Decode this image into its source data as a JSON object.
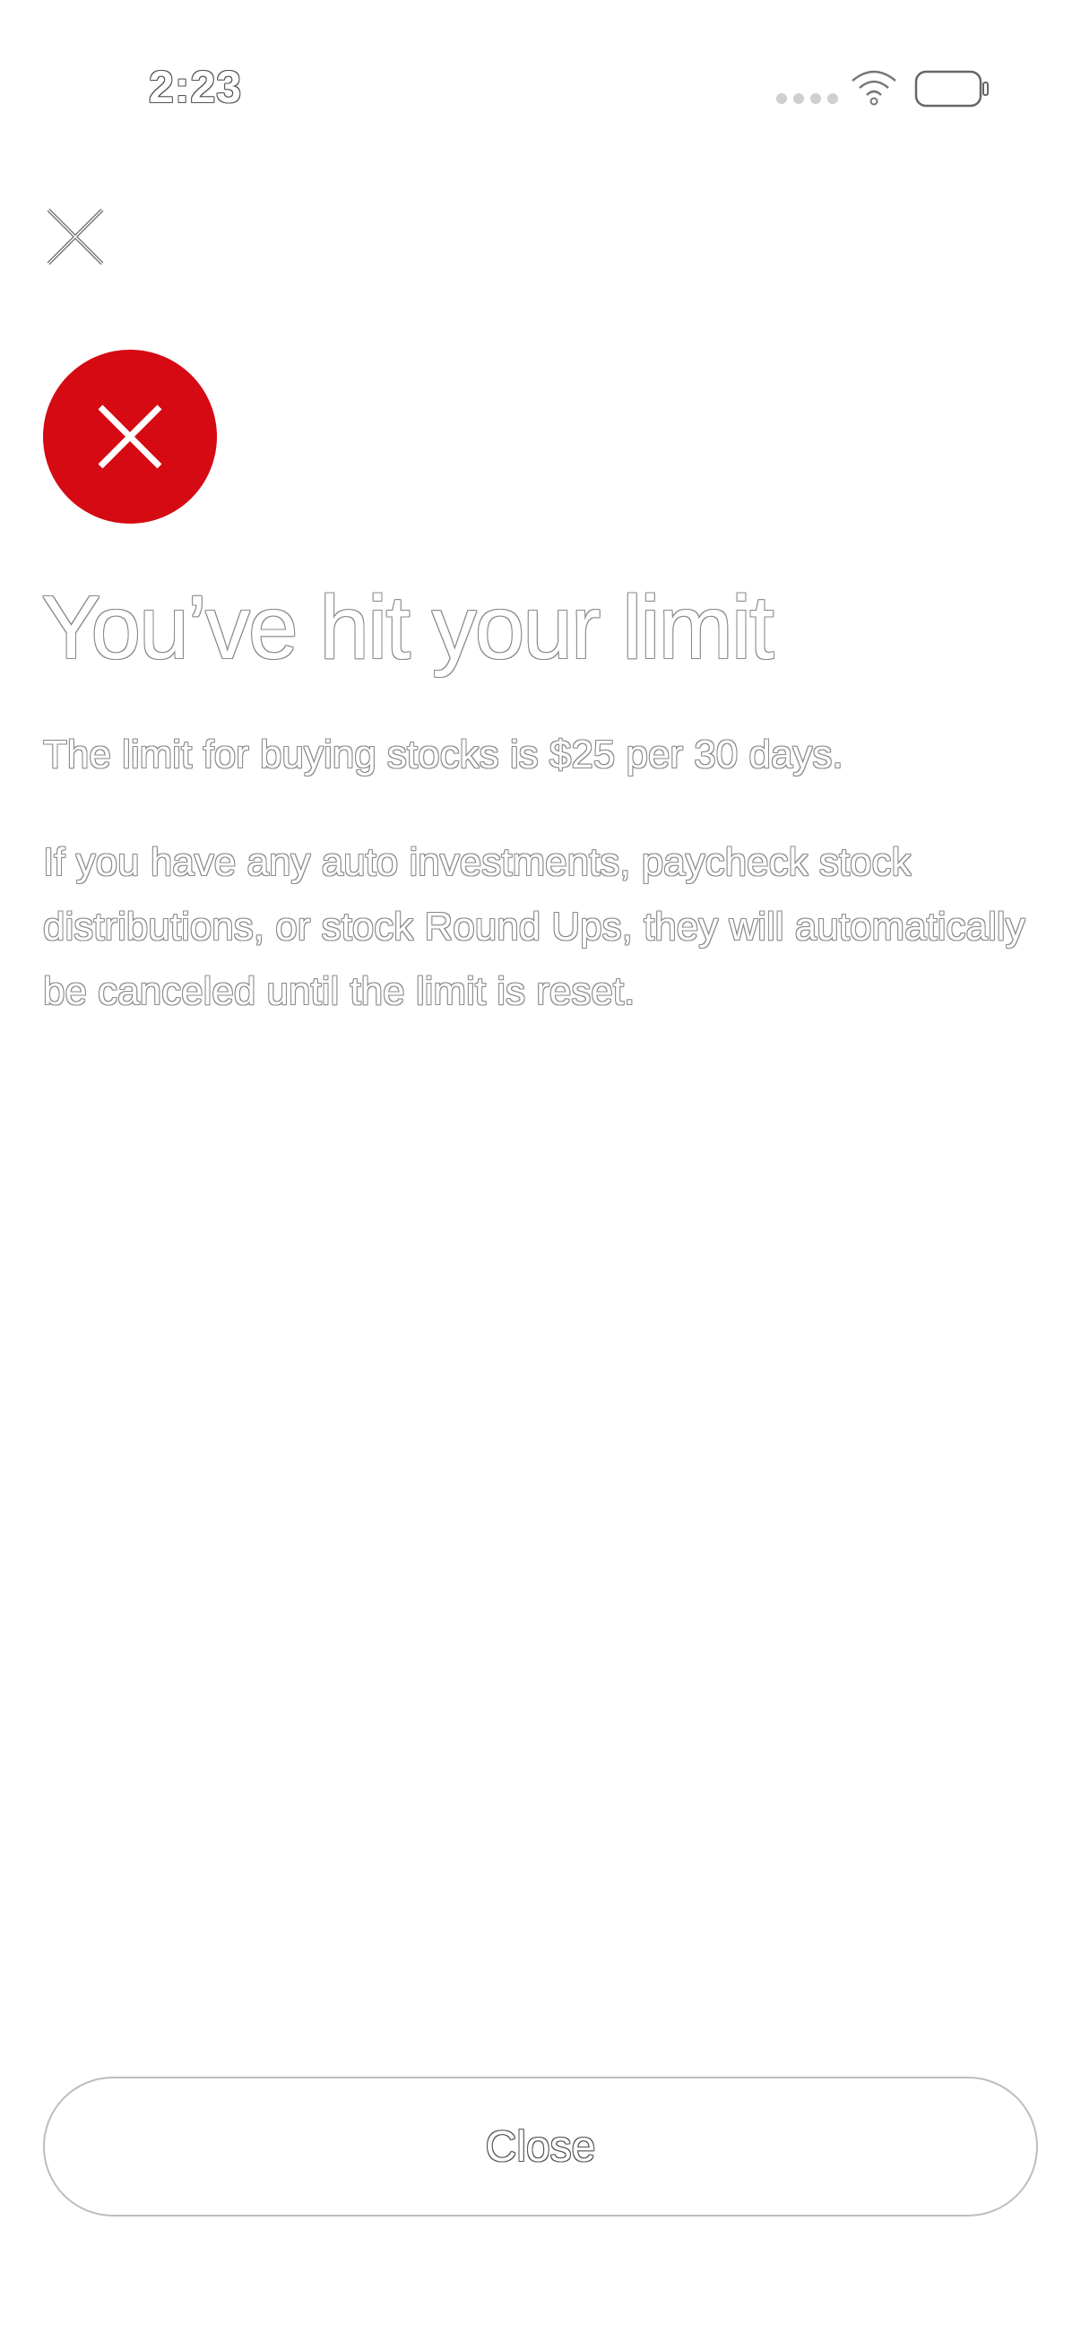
{
  "status_bar": {
    "time": "2:23",
    "signal_icon": "cellular-dots-icon",
    "wifi_icon": "wifi-icon",
    "battery_icon": "battery-icon"
  },
  "top_close": {
    "icon": "close-icon"
  },
  "error_icon": {
    "icon": "x-mark-icon",
    "color": "#d50a13"
  },
  "content": {
    "title": "You’ve hit your limit",
    "paragraph_1": "The limit for buying stocks is $25 per 30 days.",
    "paragraph_2": "If you have any auto investments, paycheck stock distributions, or stock Round Ups, they will automatically be canceled until the limit is reset."
  },
  "footer": {
    "close_label": "Close"
  }
}
